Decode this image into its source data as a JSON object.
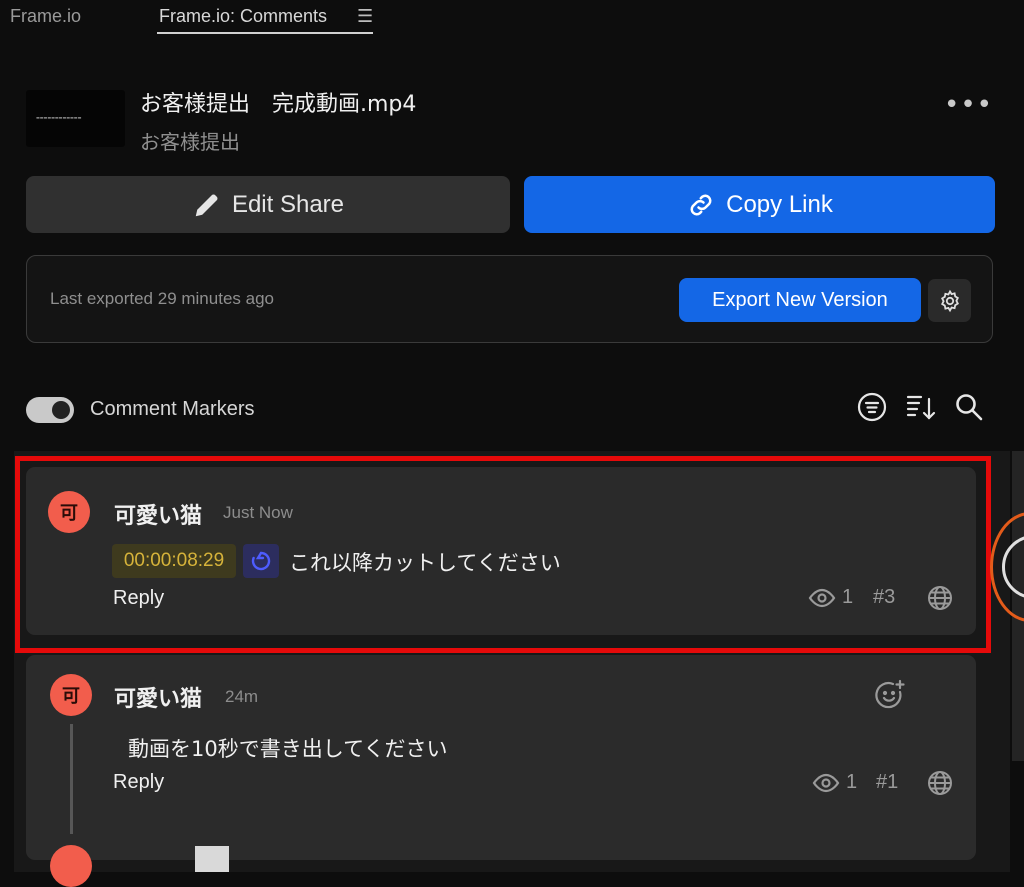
{
  "tabs": [
    {
      "label": "Frame.io"
    },
    {
      "label": "Frame.io: Comments"
    }
  ],
  "tab_menu_glyph": "☰",
  "asset": {
    "title": "お客様提出　完成動画.mp4",
    "subtitle": "お客様提出",
    "more_glyph": "•••"
  },
  "buttons": {
    "edit_share": "Edit Share",
    "copy_link": "Copy Link"
  },
  "export": {
    "status": "Last exported 29 minutes ago",
    "button": "Export New Version"
  },
  "markers": {
    "label": "Comment Markers",
    "enabled": true
  },
  "comments": [
    {
      "avatar": "可",
      "author": "可愛い猫",
      "time": "Just Now",
      "timecode": "00:00:08:29",
      "text": "これ以降カットしてください",
      "reply": "Reply",
      "views": "1",
      "number": "#3",
      "highlighted": true
    },
    {
      "avatar": "可",
      "author": "可愛い猫",
      "time": "24m",
      "text": "動画を10秒で書き出してください",
      "reply": "Reply",
      "views": "1",
      "number": "#1"
    }
  ],
  "colors": {
    "accent": "#1467e6",
    "avatar": "#f25d4c",
    "highlight_border": "#e50a0a",
    "timecode": "#d6b33a"
  },
  "icons": [
    "pencil-icon",
    "link-icon",
    "gear-icon",
    "filter-icon",
    "sort-icon",
    "search-icon",
    "range-icon",
    "eye-icon",
    "globe-icon",
    "emoji-add-icon"
  ]
}
